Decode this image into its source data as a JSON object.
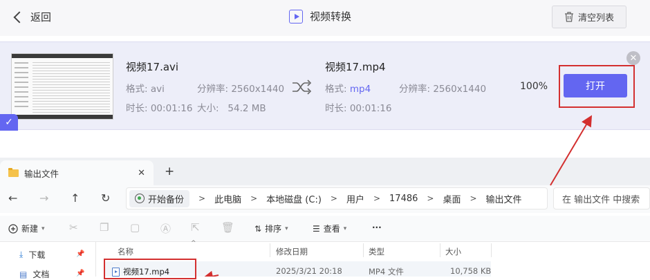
{
  "header": {
    "back_label": "返回",
    "title": "视频转换",
    "clear_label": "清空列表"
  },
  "conversion": {
    "source": {
      "name": "视频17.avi",
      "format_label": "格式:",
      "format": "avi",
      "resolution": "分辨率: 2560x1440",
      "duration": "时长: 00:01:16",
      "size": "大小:   54.2 MB"
    },
    "target": {
      "name": "视频17.mp4",
      "format_label": "格式:",
      "format": "mp4",
      "resolution": "分辨率: 2560x1440",
      "duration": "时长: 00:01:16"
    },
    "progress": "100%",
    "open_label": "打开",
    "close_symbol": "✕",
    "check_symbol": "✓"
  },
  "explorer": {
    "tab_title": "输出文件",
    "tab_close": "✕",
    "new_tab": "+",
    "nav": {
      "back": "←",
      "forward": "→",
      "up": "↑",
      "refresh": "↻"
    },
    "breadcrumbs": [
      "开始备份",
      "此电脑",
      "本地磁盘 (C:)",
      "用户",
      "17486",
      "桌面",
      "输出文件"
    ],
    "separator": ">",
    "search_placeholder": "在 输出文件 中搜索",
    "toolbar": {
      "new_label": "新建",
      "sort_label": "排序",
      "view_label": "查看",
      "more": "···"
    },
    "sidebar": [
      {
        "label": "下载",
        "icon": "download-icon"
      },
      {
        "label": "文档",
        "icon": "document-icon"
      }
    ],
    "columns": [
      "名称",
      "修改日期",
      "类型",
      "大小"
    ],
    "files": [
      {
        "name": "视频17.mp4",
        "modified": "2025/3/21 20:18",
        "type": "MP4 文件",
        "size": "10,758 KB"
      }
    ]
  },
  "colors": {
    "accent": "#6366f1",
    "highlight": "#d32f2f"
  }
}
